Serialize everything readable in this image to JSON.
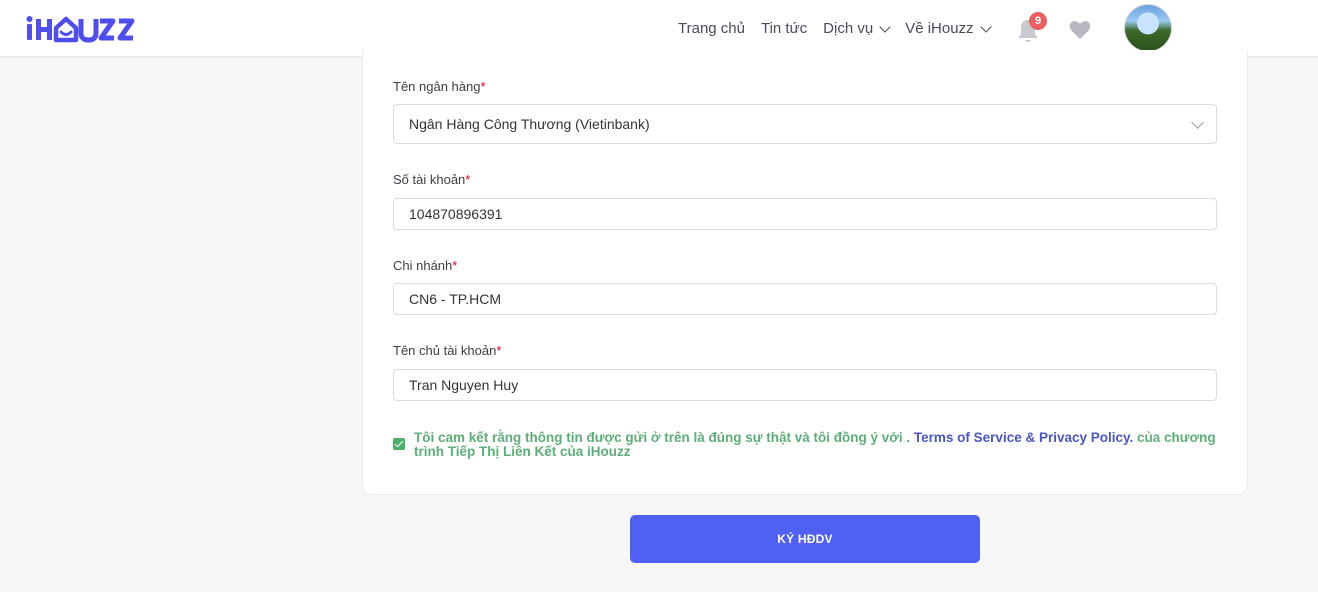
{
  "header": {
    "logo_text": "iHOUZZ",
    "nav": [
      {
        "label": "Trang chủ"
      },
      {
        "label": "Tin tức"
      },
      {
        "label": "Dịch vụ"
      },
      {
        "label": "Về iHouzz"
      }
    ],
    "notification_count": "9",
    "icons": {
      "bell": "bell-icon",
      "heart": "heart-icon",
      "avatar": "user-avatar"
    }
  },
  "form": {
    "bank": {
      "label": "Tên ngân hàng",
      "required_mark": "*",
      "value": "Ngân Hàng Công Thương (Vietinbank)"
    },
    "account_number": {
      "label": "Số tài khoản",
      "required_mark": "*",
      "value": "104870896391"
    },
    "branch": {
      "label": "Chi nhánh",
      "required_mark": "*",
      "value": "CN6 - TP.HCM"
    },
    "account_holder": {
      "label": "Tên chủ tài khoản",
      "required_mark": "*",
      "value": "Tran Nguyen Huy"
    },
    "agreement": {
      "checked": true,
      "text_before": "Tôi cam kết rằng thông tin được gửi ở trên là đúng sự thật và tôi đồng ý với . ",
      "link_text": "Terms of Service & Privacy Policy.",
      "text_after": " của chương trình Tiếp Thị Liên Kết của iHouzz"
    },
    "submit_label": "KÝ HĐDV"
  },
  "colors": {
    "brand": "#5060f5",
    "agree_text": "#5cae77",
    "link": "#4a56c5",
    "badge": "#e86060",
    "required": "#d0021b"
  }
}
